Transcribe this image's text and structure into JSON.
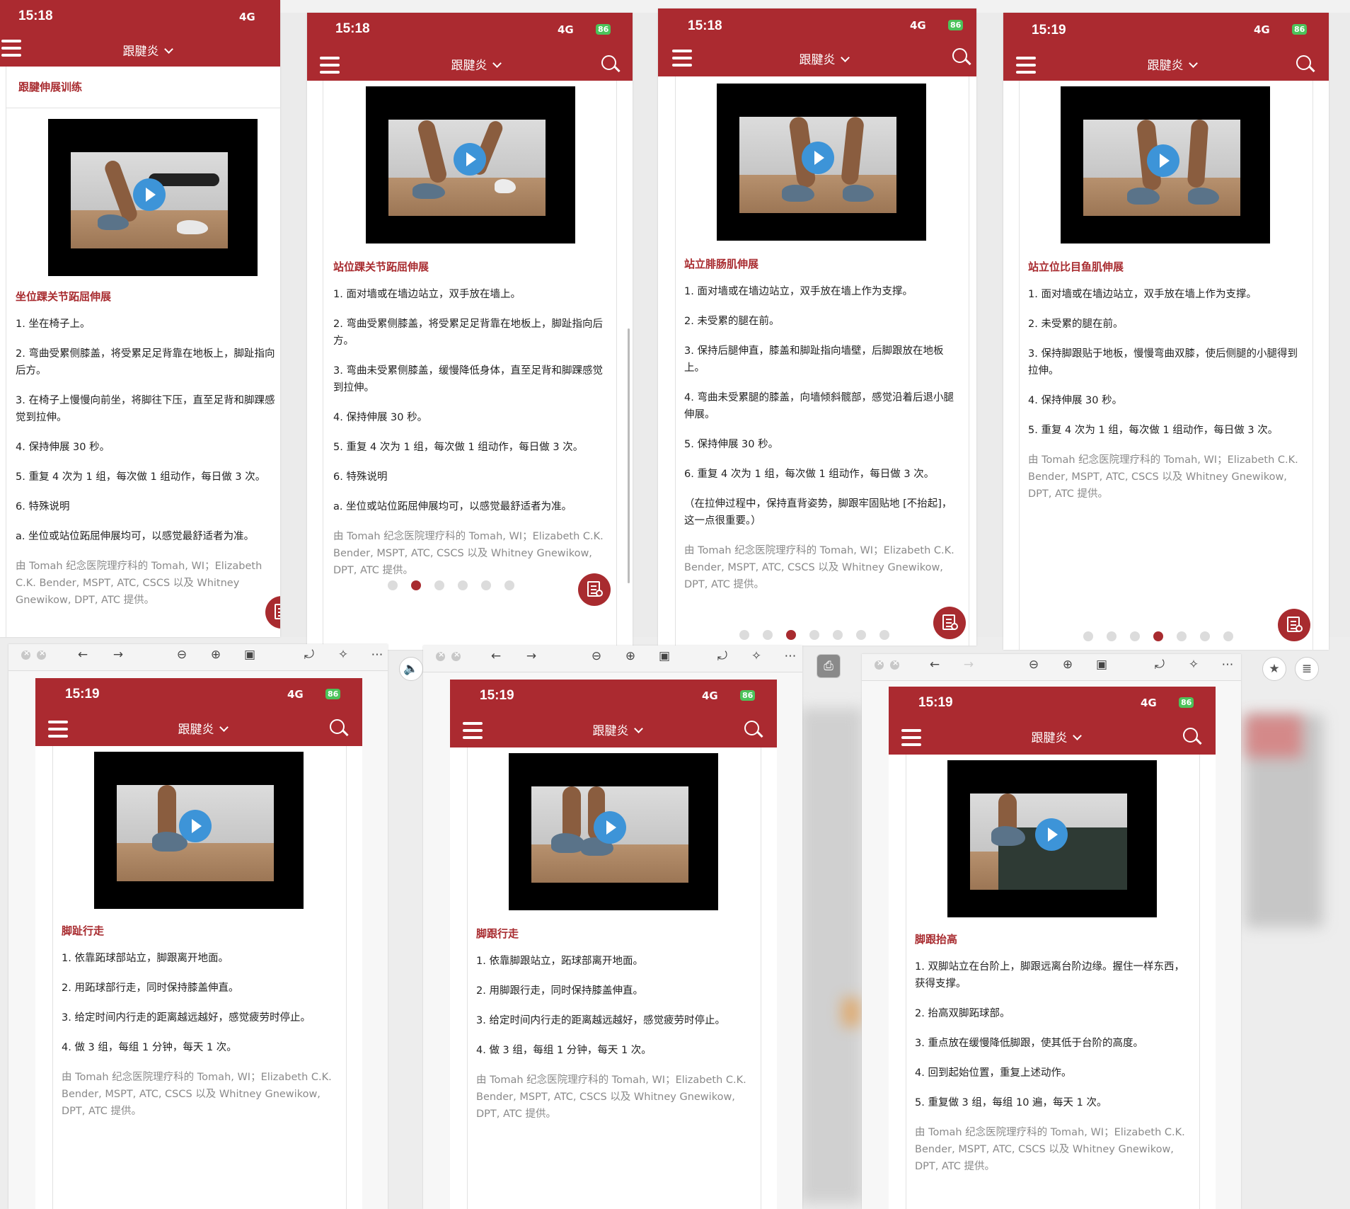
{
  "status": {
    "network": "4G",
    "battery": "86",
    "app_title": "跟腱炎"
  },
  "credit": "由 Tomah 纪念医院理疗科的 Tomah, WI；Elizabeth C.K. Bender, MSPT, ATC, CSCS 以及 Whitney Gnewikow, DPT, ATC 提供。",
  "colors": {
    "brand": "#ab2a30",
    "title_text": "#a82b2f",
    "play_button": "#3d94d8",
    "battery": "#4cc35a"
  },
  "phones": [
    {
      "time": "15:18",
      "header": "跟腱伸展训练",
      "title": "坐位踝关节跖屈伸展",
      "steps": [
        "1. 坐在椅子上。",
        "2. 弯曲受累侧膝盖，将受累足足背靠在地板上，脚趾指向后方。",
        "3. 在椅子上慢慢向前坐，将脚往下压，直至足背和脚踝感觉到拉伸。",
        "4. 保持伸展 30 秒。",
        "5. 重复 4 次为 1 组，每次做 1 组动作，每日做 3 次。",
        "6. 特殊说明",
        "a. 坐位或站位跖屈伸展均可，以感觉最舒适者为准。"
      ]
    },
    {
      "time": "15:18",
      "title": "站位踝关节跖屈伸展",
      "steps": [
        "1. 面对墙或在墙边站立，双手放在墙上。",
        "2. 弯曲受累侧膝盖，将受累足足背靠在地板上，脚趾指向后方。",
        "3. 弯曲未受累侧膝盖，缓慢降低身体，直至足背和脚踝感觉到拉伸。",
        "4. 保持伸展 30 秒。",
        "5. 重复 4 次为 1 组，每次做 1 组动作，每日做 3 次。",
        "6. 特殊说明",
        "a. 坐位或站位跖屈伸展均可，以感觉最舒适者为准。"
      ]
    },
    {
      "time": "15:18",
      "title": "站立腓肠肌伸展",
      "steps": [
        "1. 面对墙或在墙边站立，双手放在墙上作为支撑。",
        "2. 未受累的腿在前。",
        "3. 保持后腿伸直，膝盖和脚趾指向墙壁，后脚跟放在地板上。",
        "4. 弯曲未受累腿的膝盖，向墙倾斜髋部，感觉沿着后退小腿伸展。",
        "5. 保持伸展 30 秒。",
        "6. 重复 4 次为 1 组，每次做 1 组动作，每日做 3 次。",
        "（在拉伸过程中，保持直背姿势，脚跟牢固贴地 [不抬起]，这一点很重要。）"
      ]
    },
    {
      "time": "15:19",
      "title": "站立位比目鱼肌伸展",
      "steps": [
        "1. 面对墙或在墙边站立，双手放在墙上作为支撑。",
        "2. 未受累的腿在前。",
        "3. 保持脚跟贴于地板，慢慢弯曲双膝，使后侧腿的小腿得到拉伸。",
        "4. 保持伸展 30 秒。",
        "5. 重复 4 次为 1 组，每次做 1 组动作，每日做 3 次。"
      ]
    },
    {
      "time": "15:19",
      "title": "脚趾行走",
      "steps": [
        "1. 依靠跖球部站立，脚跟离开地面。",
        "2. 用跖球部行走，同时保持膝盖伸直。",
        "3. 给定时间内行走的距离越远越好，感觉疲劳时停止。",
        "4. 做 3 组，每组 1 分钟，每天 1 次。"
      ]
    },
    {
      "time": "15:19",
      "title": "脚跟行走",
      "steps": [
        "1. 依靠脚跟站立，跖球部离开地面。",
        "2. 用脚跟行走，同时保持膝盖伸直。",
        "3. 给定时间内行走的距离越远越好，感觉疲劳时停止。",
        "4. 做 3 组，每组 1 分钟，每天 1 次。"
      ]
    },
    {
      "time": "15:19",
      "title": "脚跟抬高",
      "steps": [
        "1. 双脚站立在台阶上，脚跟远离台阶边缘。握住一样东西，获得支撑。",
        "2. 抬高双脚跖球部。",
        "3. 重点放在缓慢降低脚跟，使其低于台阶的高度。",
        "4. 回到起始位置，重复上述动作。",
        "5. 重复做 3 组，每组 10 遍，每天 1 次。"
      ]
    }
  ]
}
